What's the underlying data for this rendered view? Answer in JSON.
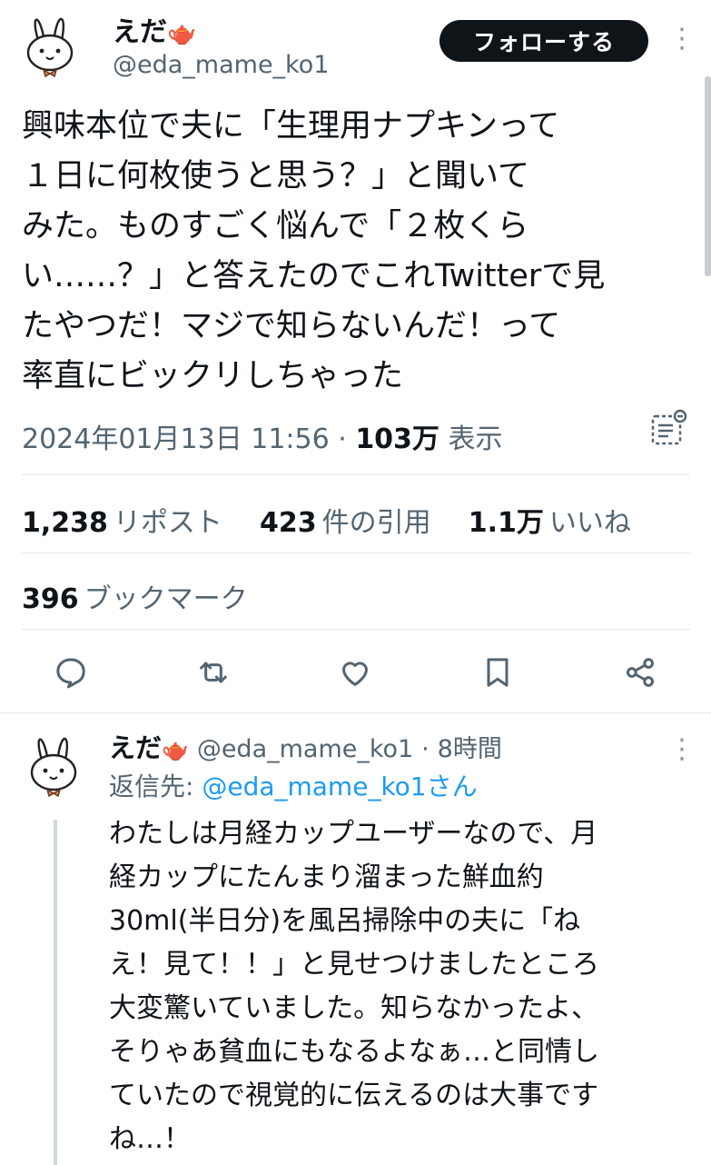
{
  "main_tweet": {
    "author": {
      "name": "えだ",
      "handle": "@eda_mame_ko1",
      "emoji": "🫖"
    },
    "follow_label": "フォローする",
    "text_lines": [
      "興味本位で夫に「生理用ナプキンって",
      "１日に何枚使うと思う？」と聞いて",
      "みた。ものすごく悩んで「２枚くら",
      "い……？」と答えたのでこれTwitterで見",
      "たやつだ！マジで知らないんだ！って",
      "率直にビックリしちゃった"
    ],
    "date": "2024年01月13日 11:56",
    "views_count": "103万",
    "views_label": "表示",
    "stats": {
      "reposts_count": "1,238",
      "reposts_label": "リポスト",
      "quotes_count": "423",
      "quotes_label": "件の引用",
      "likes_count": "1.1万",
      "likes_label": "いいね",
      "bookmarks_count": "396",
      "bookmarks_label": "ブックマーク"
    },
    "actions": [
      "reply-icon",
      "repost-icon",
      "like-icon",
      "bookmark-icon",
      "share-icon"
    ]
  },
  "reply": {
    "author": {
      "name": "えだ",
      "handle": "@eda_mame_ko1",
      "emoji": "🫖"
    },
    "time": "8時間",
    "reply_to_prefix": "返信先: ",
    "reply_to_handle": "@eda_mame_ko1さん",
    "text_lines": [
      "わたしは月経カップユーザーなので、月",
      "経カップにたんまり溜まった鮮血約",
      "30ml(半日分)を風呂掃除中の夫に「ね",
      "え！見て！！」と見せつけましたところ",
      "大変驚いていました。知らなかったよ、",
      "そりゃあ貧血にもなるよなぁ…と同情し",
      "ていたので視覚的に伝えるのは大事です",
      "ね…！"
    ]
  },
  "colors": {
    "accent": "#1d9bf0",
    "text": "#0f1419",
    "secondary": "#536471"
  }
}
